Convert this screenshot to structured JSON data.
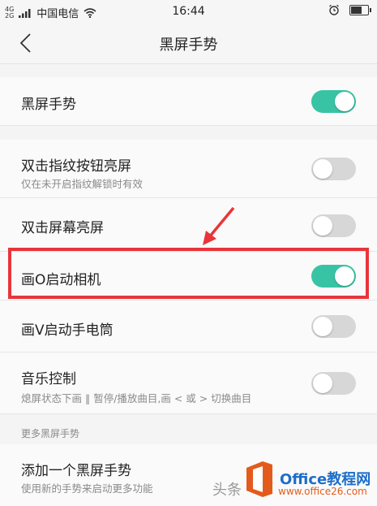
{
  "status_bar": {
    "network_tech": "4G",
    "network_tech_2": "2G",
    "carrier": "中国电信",
    "time": "16:44",
    "battery_level": 0.7
  },
  "header": {
    "title": "黑屏手势"
  },
  "settings": {
    "master": {
      "title": "黑屏手势",
      "enabled": true
    },
    "double_tap_fingerprint": {
      "title": "双击指纹按钮亮屏",
      "subtitle": "仅在未开启指纹解锁时有效",
      "enabled": false
    },
    "double_tap_screen": {
      "title": "双击屏幕亮屏",
      "enabled": false
    },
    "draw_o_camera": {
      "title": "画O启动相机",
      "enabled": true
    },
    "draw_v_flashlight": {
      "title": "画V启动手电筒",
      "enabled": false
    },
    "music_control": {
      "title": "音乐控制",
      "subtitle": "熄屏状态下画 ‖ 暂停/播放曲目,画 < 或 > 切换曲目",
      "enabled": false
    },
    "more_section_label": "更多黑屏手势",
    "add_gesture": {
      "title": "添加一个黑屏手势",
      "subtitle": "使用新的手势来启动更多功能"
    }
  },
  "colors": {
    "toggle_on": "#38c4a4",
    "toggle_off": "#d7d7d7",
    "highlight": "#e8353a"
  },
  "watermark": {
    "source": "头条",
    "site_name": "Office教程网",
    "site_url": "www.office26.com"
  }
}
